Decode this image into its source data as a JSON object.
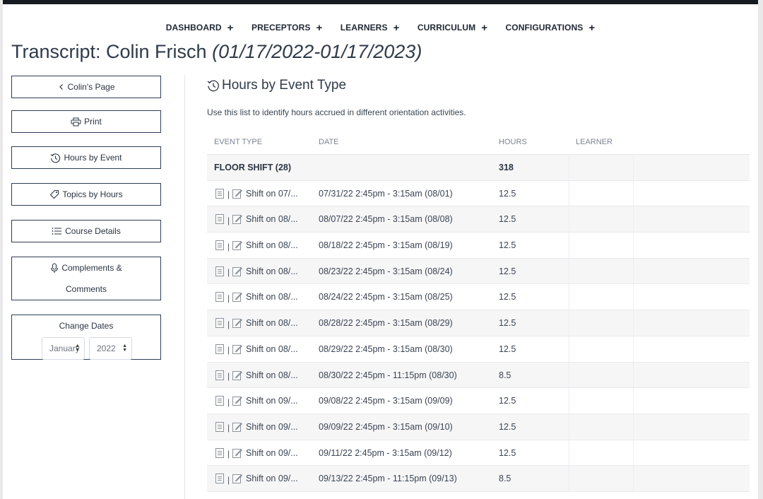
{
  "nav": {
    "items": [
      {
        "label": "DASHBOARD",
        "plus": "+"
      },
      {
        "label": "PRECEPTORS",
        "plus": "+"
      },
      {
        "label": "LEARNERS",
        "plus": "+"
      },
      {
        "label": "CURRICULUM",
        "plus": "+"
      },
      {
        "label": "CONFIGURATIONS",
        "plus": "+"
      }
    ]
  },
  "page": {
    "title": "Transcript: Colin Frisch",
    "date_range": "(01/17/2022-01/17/2023)"
  },
  "sidebar": {
    "back_label": "Colin's Page",
    "print_label": "Print",
    "hours_by_event_label": "Hours by Event",
    "topics_by_hours_label": "Topics by Hours",
    "course_details_label": "Course Details",
    "complements_line1": "Complements &",
    "complements_line2": "Comments",
    "change_dates_label": "Change Dates",
    "month_value": "January",
    "year_value": "2022"
  },
  "main": {
    "heading": "Hours by Event Type",
    "description": "Use this list to identify hours accrued in different orientation activities.",
    "columns": [
      "EVENT TYPE",
      "DATE",
      "HOURS",
      "LEARNER"
    ],
    "group": {
      "name": "FLOOR SHIFT (28)",
      "hours": "318"
    },
    "rows": [
      {
        "event": "Shift on 07/...",
        "date": "07/31/22 2:45pm - 3:15am (08/01)",
        "hours": "12.5"
      },
      {
        "event": "Shift on 08/...",
        "date": "08/07/22 2:45pm - 3:15am (08/08)",
        "hours": "12.5"
      },
      {
        "event": "Shift on 08/...",
        "date": "08/18/22 2:45pm - 3:15am (08/19)",
        "hours": "12.5"
      },
      {
        "event": "Shift on 08/...",
        "date": "08/23/22 2:45pm - 3:15am (08/24)",
        "hours": "12.5"
      },
      {
        "event": "Shift on 08/...",
        "date": "08/24/22 2:45pm - 3:15am (08/25)",
        "hours": "12.5"
      },
      {
        "event": "Shift on 08/...",
        "date": "08/28/22 2:45pm - 3:15am (08/29)",
        "hours": "12.5"
      },
      {
        "event": "Shift on 08/...",
        "date": "08/29/22 2:45pm - 3:15am (08/30)",
        "hours": "12.5"
      },
      {
        "event": "Shift on 08/...",
        "date": "08/30/22 2:45pm - 11:15pm (08/30)",
        "hours": "8.5"
      },
      {
        "event": "Shift on 09/...",
        "date": "09/08/22 2:45pm - 3:15am (09/09)",
        "hours": "12.5"
      },
      {
        "event": "Shift on 09/...",
        "date": "09/09/22 2:45pm - 3:15am (09/10)",
        "hours": "12.5"
      },
      {
        "event": "Shift on 09/...",
        "date": "09/11/22 2:45pm - 3:15am (09/12)",
        "hours": "12.5"
      },
      {
        "event": "Shift on 09/...",
        "date": "09/13/22 2:45pm - 11:15pm (09/13)",
        "hours": "8.5"
      }
    ],
    "row_separator": "|"
  },
  "icons": {
    "back": "chevron-left-icon",
    "print": "printer-icon",
    "hours": "history-icon",
    "topics": "tag-icon",
    "course": "list-icon",
    "complements": "microphone-icon",
    "row_view": "document-icon",
    "row_edit": "edit-icon"
  }
}
